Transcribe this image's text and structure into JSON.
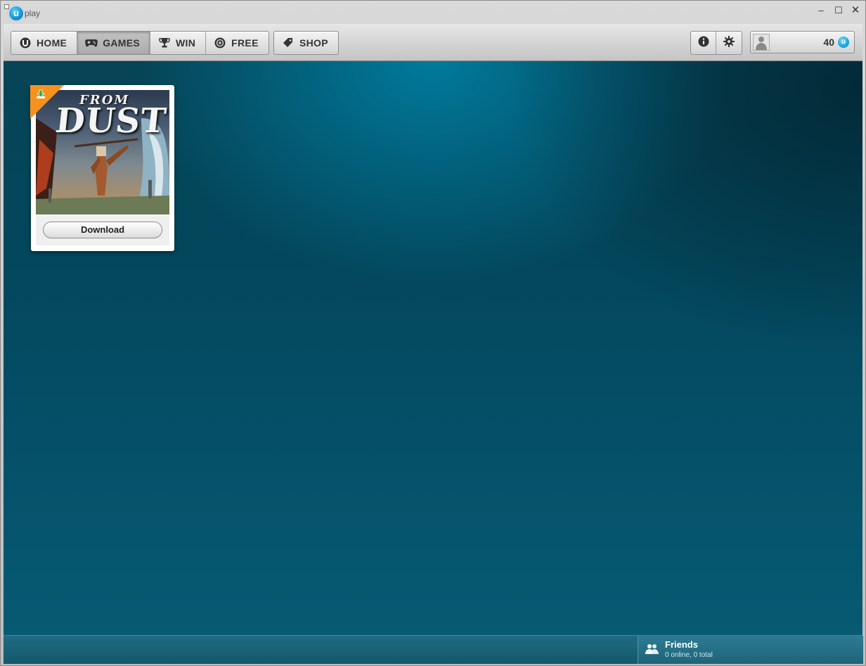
{
  "app": {
    "logo_text": "play",
    "logo_letter": "u"
  },
  "window_controls": {
    "minimize": "–",
    "maximize": "☐",
    "close": "✕"
  },
  "nav": {
    "items": [
      {
        "label": "HOME",
        "icon": "uplay-icon"
      },
      {
        "label": "GAMES",
        "icon": "gamepad-icon",
        "active": true
      },
      {
        "label": "WIN",
        "icon": "trophy-icon"
      },
      {
        "label": "FREE",
        "icon": "free-icon"
      }
    ],
    "shop": {
      "label": "SHOP",
      "icon": "tag-icon"
    }
  },
  "tools": {
    "info_icon": "info-icon",
    "settings_icon": "gear-icon"
  },
  "profile": {
    "points": "40",
    "currency_letter": "u"
  },
  "games": [
    {
      "title_small": "FROM",
      "title_big": "DUST",
      "action_label": "Download",
      "ribbon_icon": "download-icon",
      "ribbon_color": "#f5921e"
    }
  ],
  "friends": {
    "title": "Friends",
    "status": "0 online, 0 total"
  },
  "colors": {
    "accent": "#0a86c4",
    "background": "#05516a",
    "ribbon": "#f5921e"
  }
}
